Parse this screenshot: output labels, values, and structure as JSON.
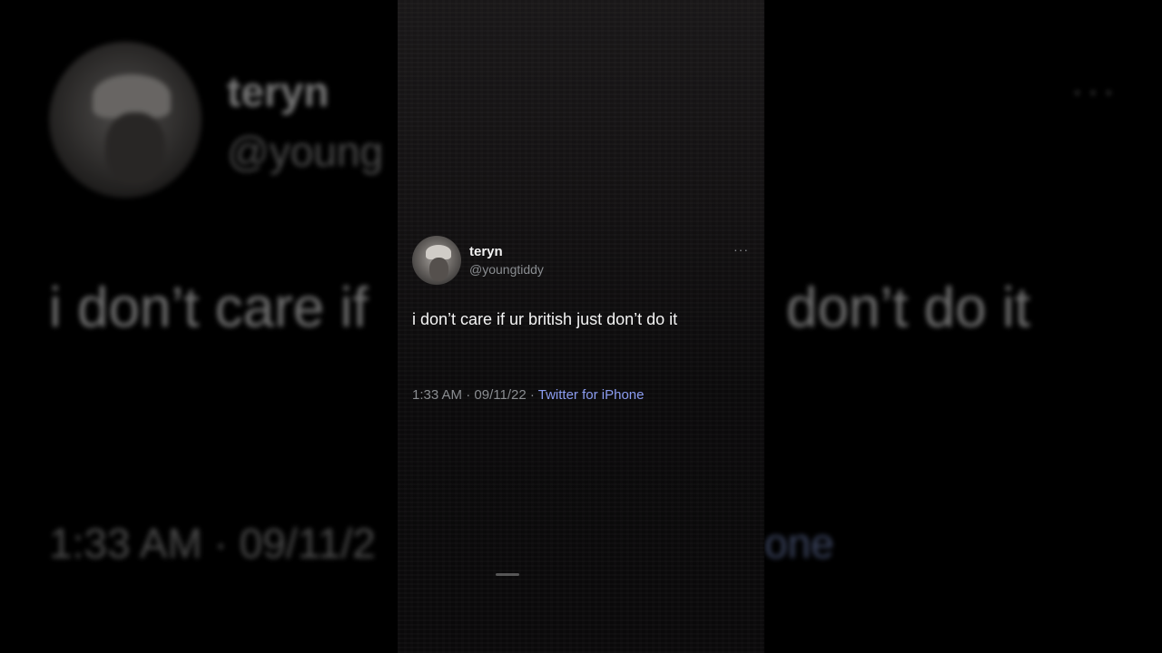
{
  "tweet": {
    "display_name": "teryn",
    "handle": "@youngtiddy",
    "more_label": "···",
    "text": "i don’t care if ur british just don’t do it",
    "time": "1:33 AM",
    "separator": "·",
    "date": "09/11/22",
    "source": "Twitter for iPhone"
  },
  "background_blur": {
    "display_name": "teryn",
    "handle_partial": "@young",
    "text_left": "i don’t care if",
    "text_right": "don’t do it",
    "meta_left": "1:33 AM · 09/11/2",
    "meta_right": "one",
    "more_label": "···"
  },
  "colors": {
    "background": "#000000",
    "text_primary": "#f4f4f4",
    "text_secondary": "#8a8d91",
    "source_link": "#8b9cf0"
  }
}
